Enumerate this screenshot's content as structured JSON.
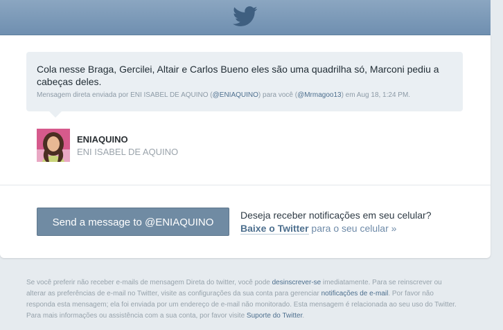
{
  "header": {
    "logo_icon": "twitter-bird-icon"
  },
  "message": {
    "text": "Cola nesse Braga, Gercilei, Altair e Carlos Bueno eles são uma quadrilha só, Marconi pediu a cabeças deles.",
    "meta_prefix": "Mensagem direta enviada por ENI ISABEL DE AQUINO (",
    "meta_sender_handle": "@ENIAQUINO",
    "meta_middle": ") para você (",
    "meta_recipient_handle": "@Mrmagoo13",
    "meta_suffix": ") em Aug 18, 1:24 PM."
  },
  "sender": {
    "handle": "ENIAQUINO",
    "name": "ENI ISABEL DE AQUINO",
    "avatar_icon": "user-avatar"
  },
  "actions": {
    "send_label": "Send a message to @ENIAQUINO"
  },
  "promo": {
    "question": "Deseja receber notificações em seu celular?",
    "link_label": "Baixe o Twitter",
    "suffix": " para o seu celular »"
  },
  "footer": {
    "p1": "Se você preferir não receber e-mails de mensagem Direta do twitter, você pode ",
    "unsubscribe_link": "desinscrever-se",
    "p2": " imediatamente. Para se reinscrever ou alterar as preferências de e-mail no Twitter, visite as configurações da sua conta para gerenciar ",
    "notifications_link": "notificações de e-mail",
    "p3": ". Por favor não responda esta mensagem; ela foi enviada por um endereço de e-mail não monitorado. Esta mensagem é relacionada ao seu uso do Twitter. Para mais informações ou assistência com a sua conta, por favor visite ",
    "support_link": "Suporte do Twitter",
    "p4": "."
  },
  "colors": {
    "header": "#7f9cba",
    "button": "#708ba3",
    "link": "#4d6f8e",
    "bubble": "#eaeff3",
    "page_background": "#e6ebef"
  }
}
